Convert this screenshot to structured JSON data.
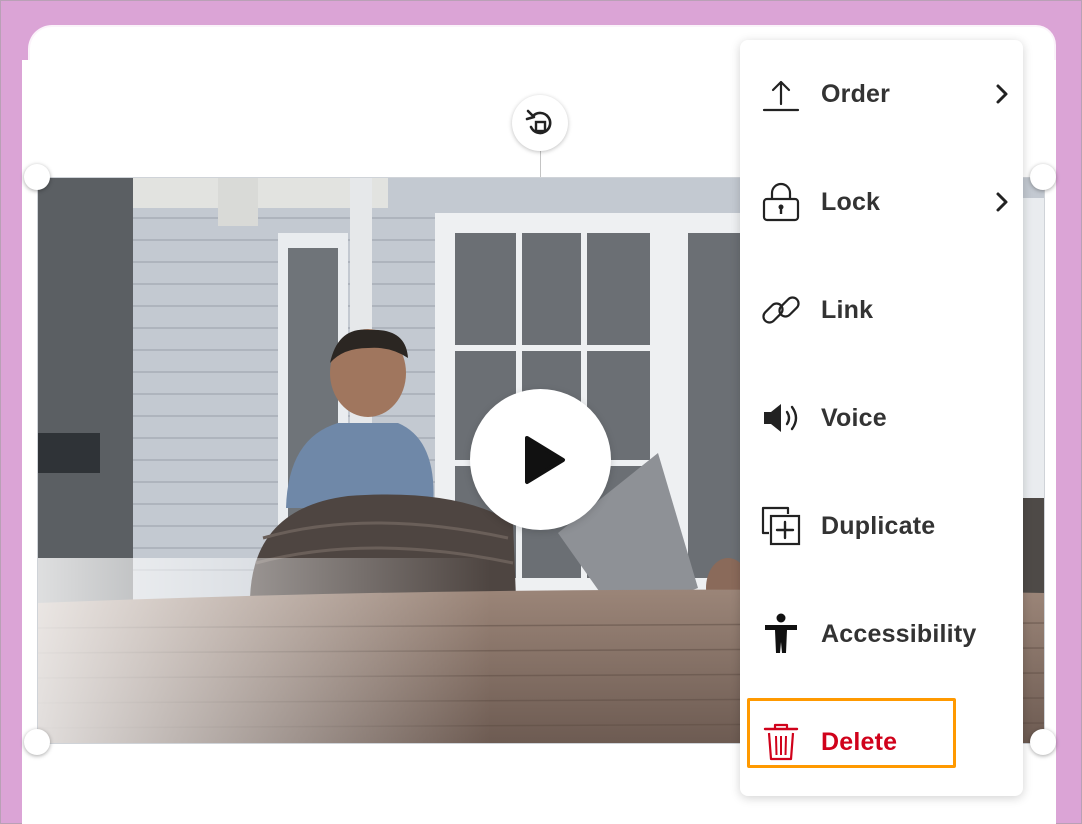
{
  "menu": {
    "items": [
      {
        "id": "order",
        "label": "Order",
        "icon": "order-up-icon",
        "has_submenu": true
      },
      {
        "id": "lock",
        "label": "Lock",
        "icon": "lock-icon",
        "has_submenu": true
      },
      {
        "id": "link",
        "label": "Link",
        "icon": "link-icon",
        "has_submenu": false
      },
      {
        "id": "voice",
        "label": "Voice",
        "icon": "speaker-icon",
        "has_submenu": false
      },
      {
        "id": "duplicate",
        "label": "Duplicate",
        "icon": "duplicate-icon",
        "has_submenu": false
      },
      {
        "id": "accessibility",
        "label": "Accessibility",
        "icon": "accessibility-icon",
        "has_submenu": false
      },
      {
        "id": "delete",
        "label": "Delete",
        "icon": "trash-icon",
        "has_submenu": false,
        "highlighted": true
      }
    ]
  },
  "colors": {
    "background": "#dba4d6",
    "delete": "#d0021b",
    "highlight": "#ff9900",
    "text": "#333333"
  }
}
